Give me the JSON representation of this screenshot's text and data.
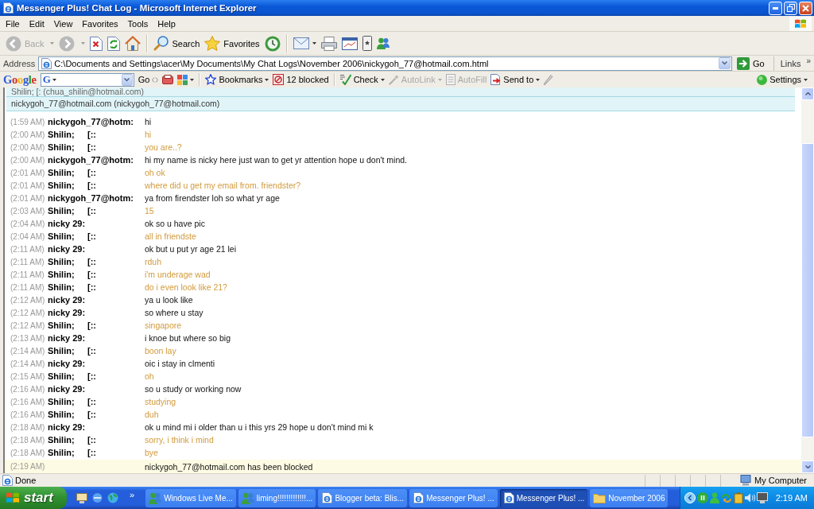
{
  "window": {
    "title": "Messenger Plus! Chat Log - Microsoft Internet Explorer"
  },
  "menu_bar": [
    "File",
    "Edit",
    "View",
    "Favorites",
    "Tools",
    "Help"
  ],
  "toolbar": {
    "back": {
      "label": "Back",
      "disabled": true
    },
    "forward": {
      "disabled": true
    },
    "search": {
      "label": "Search",
      "disabled": false
    },
    "favorites": {
      "label": "Favorites",
      "disabled": false
    }
  },
  "address_bar": {
    "label": "Address",
    "value": "C:\\Documents and Settings\\acer\\My Documents\\My Chat Logs\\November 2006\\nickygoh_77@hotmail.com.html",
    "go": "Go",
    "links": "Links",
    "links_more": "»"
  },
  "google_toolbar": {
    "logo": "Google",
    "engine": "G",
    "go": "Go",
    "buttons": [
      {
        "label": "Bookmarks",
        "disabled": false
      },
      {
        "label": "12 blocked",
        "disabled": false
      },
      {
        "label": "Check",
        "disabled": false
      },
      {
        "label": "AutoLink",
        "disabled": true
      },
      {
        "label": "AutoFill",
        "disabled": true
      },
      {
        "label": "Send to",
        "disabled": false
      }
    ],
    "settings": "Settings"
  },
  "chat_log": {
    "participants": [
      "Shilin;     [: (chua_shilin@hotmail.com)",
      "nickygoh_77@hotmail.com (nickygoh_77@hotmail.com)"
    ],
    "messages": [
      {
        "time": "(1:59 AM)",
        "name": "nickygoh_77@hotm:",
        "text": "hi",
        "kind": "contact"
      },
      {
        "time": "(2:00 AM)",
        "name": "Shilin;",
        "tag": "[::",
        "text": "hi",
        "kind": "self"
      },
      {
        "time": "(2:00 AM)",
        "name": "Shilin;",
        "tag": "[::",
        "text": "you are..?",
        "kind": "self"
      },
      {
        "time": "(2:00 AM)",
        "name": "nickygoh_77@hotm:",
        "text": "hi my name is nicky here just wan to get yr attention hope u don't mind.",
        "kind": "contact"
      },
      {
        "time": "(2:01 AM)",
        "name": "Shilin;",
        "tag": "[::",
        "text": "oh ok",
        "kind": "self"
      },
      {
        "time": "(2:01 AM)",
        "name": "Shilin;",
        "tag": "[::",
        "text": "where did u get my email from. friendster?",
        "kind": "self"
      },
      {
        "time": "(2:01 AM)",
        "name": "nickygoh_77@hotm:",
        "text": "ya from firendster loh so what yr age",
        "kind": "contact"
      },
      {
        "time": "(2:03 AM)",
        "name": "Shilin;",
        "tag": "[::",
        "text": "15",
        "kind": "self"
      },
      {
        "time": "(2:04 AM)",
        "name": "nicky 29:",
        "text": "ok so u have pic",
        "kind": "contact"
      },
      {
        "time": "(2:04 AM)",
        "name": "Shilin;",
        "tag": "[::",
        "text": "all in friendste",
        "kind": "self"
      },
      {
        "time": "(2:11 AM)",
        "name": "nicky 29:",
        "text": "ok but u put yr age 21 lei",
        "kind": "contact"
      },
      {
        "time": "(2:11 AM)",
        "name": "Shilin;",
        "tag": "[::",
        "text": "rduh",
        "kind": "self"
      },
      {
        "time": "(2:11 AM)",
        "name": "Shilin;",
        "tag": "[::",
        "text": "i'm underage wad",
        "kind": "self"
      },
      {
        "time": "(2:11 AM)",
        "name": "Shilin;",
        "tag": "[::",
        "text": "do i even look like 21?",
        "kind": "self"
      },
      {
        "time": "(2:12 AM)",
        "name": "nicky 29:",
        "text": "ya u look like",
        "kind": "contact"
      },
      {
        "time": "(2:12 AM)",
        "name": "nicky 29:",
        "text": "so where u stay",
        "kind": "contact"
      },
      {
        "time": "(2:12 AM)",
        "name": "Shilin;",
        "tag": "[::",
        "text": "singapore",
        "kind": "self"
      },
      {
        "time": "(2:13 AM)",
        "name": "nicky 29:",
        "text": "i knoe but where so big",
        "kind": "contact"
      },
      {
        "time": "(2:14 AM)",
        "name": "Shilin;",
        "tag": "[::",
        "text": "boon lay",
        "kind": "self"
      },
      {
        "time": "(2:14 AM)",
        "name": "nicky 29:",
        "text": "oic i stay in clmenti",
        "kind": "contact"
      },
      {
        "time": "(2:15 AM)",
        "name": "Shilin;",
        "tag": "[::",
        "text": "oh",
        "kind": "self"
      },
      {
        "time": "(2:16 AM)",
        "name": "nicky 29:",
        "text": "so u study or working now",
        "kind": "contact"
      },
      {
        "time": "(2:16 AM)",
        "name": "Shilin;",
        "tag": "[::",
        "text": "studying",
        "kind": "self"
      },
      {
        "time": "(2:16 AM)",
        "name": "Shilin;",
        "tag": "[::",
        "text": "duh",
        "kind": "self"
      },
      {
        "time": "(2:18 AM)",
        "name": "nicky 29:",
        "text": "ok u mind mi i older than u i this yrs 29 hope u don't mind mi k",
        "kind": "contact"
      },
      {
        "time": "(2:18 AM)",
        "name": "Shilin;",
        "tag": "[::",
        "text": "sorry, i think i mind",
        "kind": "self"
      },
      {
        "time": "(2:18 AM)",
        "name": "Shilin;",
        "tag": "[::",
        "text": "bye",
        "kind": "self"
      },
      {
        "time": "(2:19 AM)",
        "text": "nickygoh_77@hotmail.com has been blocked",
        "kind": "event"
      }
    ]
  },
  "status_bar": {
    "text": "Done",
    "zone": "My Computer"
  },
  "taskbar": {
    "start": "start",
    "quick_launch_more": "»",
    "tasks": [
      {
        "label": "Windows Live Me...",
        "selected": false
      },
      {
        "label": "liming!!!!!!!!!!!!!...",
        "selected": false
      },
      {
        "label": "Blogger beta: Blis...",
        "selected": false
      },
      {
        "label": "Messenger Plus! ...",
        "selected": false
      },
      {
        "label": "Messenger Plus! ...",
        "selected": true
      },
      {
        "label": "November 2006",
        "selected": false
      }
    ],
    "clock": "2:19 AM"
  }
}
